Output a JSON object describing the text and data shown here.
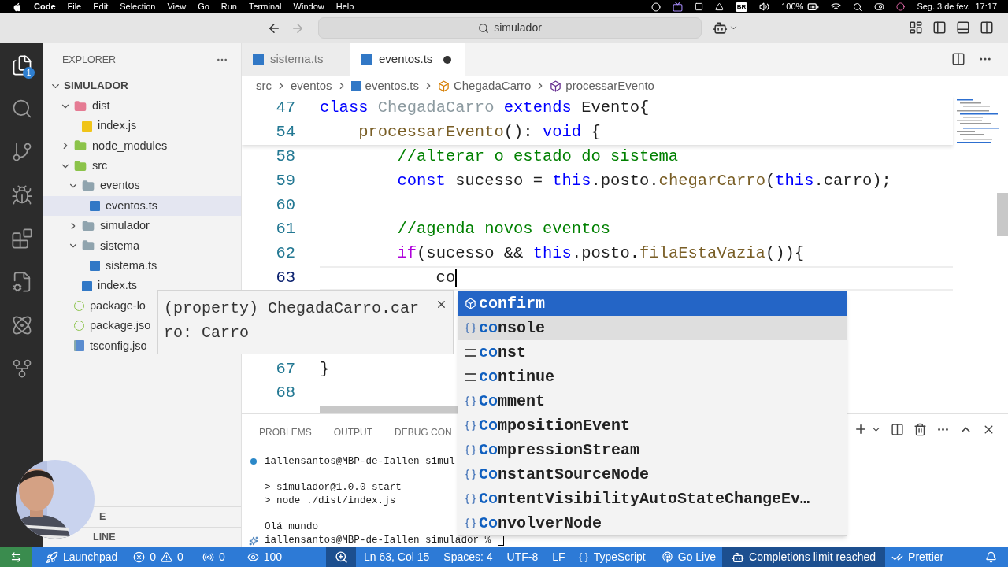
{
  "menubar": {
    "app": "Code",
    "menus": [
      "File",
      "Edit",
      "Selection",
      "View",
      "Go",
      "Run",
      "Terminal",
      "Window",
      "Help"
    ],
    "keyboard": "BR",
    "battery": "100%",
    "date": "Seg. 3 de fev.",
    "time": "17:17"
  },
  "titlebar": {
    "search": "simulador"
  },
  "activity_bar": [
    {
      "kind": "files",
      "selected": true,
      "badge": "1"
    },
    {
      "kind": "search",
      "selected": false
    },
    {
      "kind": "source_control",
      "selected": false
    },
    {
      "kind": "debug",
      "selected": false
    },
    {
      "kind": "extensions",
      "selected": false
    },
    {
      "kind": "remote",
      "selected": false
    },
    {
      "kind": "react",
      "selected": false
    },
    {
      "kind": "git_graph",
      "selected": false
    }
  ],
  "sidebar": {
    "title": "EXPLORER",
    "root": "SIMULADOR",
    "root_expanded": true,
    "tree": [
      {
        "name": "dist",
        "kind": "folder",
        "color": "#e57b93",
        "expanded": true,
        "selected": false,
        "children": [
          {
            "name": "index.js",
            "kind": "js",
            "selected": false
          }
        ]
      },
      {
        "name": "node_modules",
        "kind": "folder",
        "color": "#8bc34a",
        "expanded": false,
        "selected": false
      },
      {
        "name": "src",
        "kind": "folder",
        "color": "#8bc34a",
        "expanded": true,
        "selected": false,
        "children": [
          {
            "name": "eventos",
            "kind": "folder",
            "color": "#90a4ae",
            "expanded": true,
            "selected": false,
            "children": [
              {
                "name": "eventos.ts",
                "kind": "ts",
                "selected": true
              }
            ]
          },
          {
            "name": "simulador",
            "kind": "folder",
            "color": "#90a4ae",
            "expanded": false,
            "selected": false
          },
          {
            "name": "sistema",
            "kind": "folder",
            "color": "#90a4ae",
            "expanded": true,
            "selected": false,
            "children": [
              {
                "name": "sistema.ts",
                "kind": "ts",
                "selected": false
              }
            ]
          },
          {
            "name": "index.ts",
            "kind": "ts",
            "selected": false
          }
        ]
      },
      {
        "name": "package-lo",
        "kind": "json",
        "selected": false
      },
      {
        "name": "package.jso",
        "kind": "json",
        "selected": false
      },
      {
        "name": "tsconfig.jso",
        "kind": "tsconfig",
        "selected": false
      }
    ],
    "sections": [
      "E",
      "LINE"
    ]
  },
  "tabs": [
    {
      "label": "sistema.ts",
      "selected": false,
      "modified": false
    },
    {
      "label": "eventos.ts",
      "selected": true,
      "modified": true
    }
  ],
  "breadcrumb": [
    {
      "label": "src",
      "kind": "folder"
    },
    {
      "label": "eventos",
      "kind": "folder"
    },
    {
      "label": "eventos.ts",
      "kind": "ts"
    },
    {
      "label": "ChegadaCarro",
      "kind": "class"
    },
    {
      "label": "processarEvento",
      "kind": "method"
    }
  ],
  "code": {
    "sticky": [
      {
        "number": "47",
        "tokens": [
          {
            "text": "class",
            "kind": "kw"
          },
          {
            "text": " ChegadaCarro ",
            "kind": "faded"
          },
          {
            "text": "extends",
            "kind": "kw"
          },
          {
            "text": " Evento{",
            "kind": "plain"
          }
        ]
      },
      {
        "number": "54",
        "tokens": [
          {
            "text": "    processarEvento",
            "kind": "fn"
          },
          {
            "text": "(): ",
            "kind": "plain"
          },
          {
            "text": "void",
            "kind": "kw"
          },
          {
            "text": " {",
            "kind": "plain"
          }
        ]
      }
    ],
    "lines": [
      {
        "number": "58",
        "current": false,
        "tokens": [
          {
            "text": "        //alterar o estado do sistema",
            "kind": "cmt"
          }
        ]
      },
      {
        "number": "59",
        "current": false,
        "tokens": [
          {
            "text": "        const",
            "kind": "kw"
          },
          {
            "text": " sucesso = ",
            "kind": "plain"
          },
          {
            "text": "this",
            "kind": "kw"
          },
          {
            "text": ".posto.",
            "kind": "plain"
          },
          {
            "text": "chegarCarro",
            "kind": "fn"
          },
          {
            "text": "(",
            "kind": "plain"
          },
          {
            "text": "this",
            "kind": "kw"
          },
          {
            "text": ".carro);",
            "kind": "plain"
          }
        ]
      },
      {
        "number": "60",
        "current": false
      },
      {
        "number": "61",
        "current": false,
        "tokens": [
          {
            "text": "        //agenda novos eventos",
            "kind": "cmt"
          }
        ]
      },
      {
        "number": "62",
        "current": false,
        "tokens": [
          {
            "text": "        if",
            "kind": "ctrl"
          },
          {
            "text": "(sucesso && ",
            "kind": "plain"
          },
          {
            "text": "this",
            "kind": "kw"
          },
          {
            "text": ".posto.",
            "kind": "plain"
          },
          {
            "text": "filaEstaVazia",
            "kind": "fn"
          },
          {
            "text": "()){",
            "kind": "plain"
          }
        ]
      },
      {
        "number": "63",
        "current": true,
        "tokens": [
          {
            "text": "            co",
            "kind": "plain"
          }
        ]
      },
      {
        "number": "67",
        "current": false,
        "tokens": [
          {
            "text": "}",
            "kind": "plain"
          }
        ]
      },
      {
        "number": "68",
        "current": false
      }
    ]
  },
  "hover": {
    "text": "(property) ChegadaCarro.carro: Carro"
  },
  "suggest": {
    "items": [
      {
        "match": "co",
        "rest": "nfirm",
        "kind": "function",
        "selected": true,
        "hovered": false
      },
      {
        "match": "co",
        "rest": "nsole",
        "kind": "variable",
        "selected": false,
        "hovered": true
      },
      {
        "match": "co",
        "rest": "nst",
        "kind": "keyword",
        "selected": false,
        "hovered": false
      },
      {
        "match": "co",
        "rest": "ntinue",
        "kind": "keyword",
        "selected": false,
        "hovered": false
      },
      {
        "match": "Co",
        "rest": "mment",
        "kind": "variable",
        "selected": false,
        "hovered": false
      },
      {
        "match": "Co",
        "rest": "mpositionEvent",
        "kind": "variable",
        "selected": false,
        "hovered": false
      },
      {
        "match": "Co",
        "rest": "mpressionStream",
        "kind": "variable",
        "selected": false,
        "hovered": false
      },
      {
        "match": "Co",
        "rest": "nstantSourceNode",
        "kind": "variable",
        "selected": false,
        "hovered": false
      },
      {
        "match": "Co",
        "rest": "ntentVisibilityAutoStateChangeEv…",
        "kind": "variable",
        "selected": false,
        "hovered": false
      },
      {
        "match": "Co",
        "rest": "nvolverNode",
        "kind": "variable",
        "selected": false,
        "hovered": false
      }
    ]
  },
  "panel": {
    "tabs": [
      {
        "label": "PROBLEMS",
        "selected": false
      },
      {
        "label": "OUTPUT",
        "selected": false
      },
      {
        "label": "DEBUG CON",
        "selected": false
      }
    ],
    "terminal": [
      {
        "kind": "prompt_done",
        "text": "iallensantos@MBP-de-Iallen simul",
        "blank_after": true
      },
      {
        "kind": "output",
        "text": "> simulador@1.0.0 start",
        "blank_after": false
      },
      {
        "kind": "output",
        "text": "> node ./dist/index.js",
        "blank_after": true
      },
      {
        "kind": "output",
        "text": "Olá mundo",
        "blank_after": false
      },
      {
        "kind": "prompt_active",
        "text": "iallensantos@MBP-de-Iallen simulador %",
        "blank_after": false
      }
    ]
  },
  "status_bar": [
    {
      "kind": "remote"
    },
    {
      "kind": "launchpad",
      "label": "Launchpad"
    },
    {
      "kind": "problems",
      "errors": "0",
      "warnings": "0"
    },
    {
      "kind": "ports",
      "label": "0"
    },
    {
      "kind": "watch",
      "label": "100"
    },
    {
      "kind": "zoom"
    },
    {
      "kind": "text",
      "label": "Ln 63, Col 15"
    },
    {
      "kind": "text",
      "label": "Spaces: 4"
    },
    {
      "kind": "text",
      "label": "UTF-8"
    },
    {
      "kind": "text",
      "label": "LF"
    },
    {
      "kind": "language",
      "label": "TypeScript"
    },
    {
      "kind": "golive",
      "label": "Go Live"
    },
    {
      "kind": "copilot",
      "label": "Completions limit reached"
    },
    {
      "kind": "prettier",
      "label": "Prettier"
    },
    {
      "kind": "bell"
    }
  ]
}
